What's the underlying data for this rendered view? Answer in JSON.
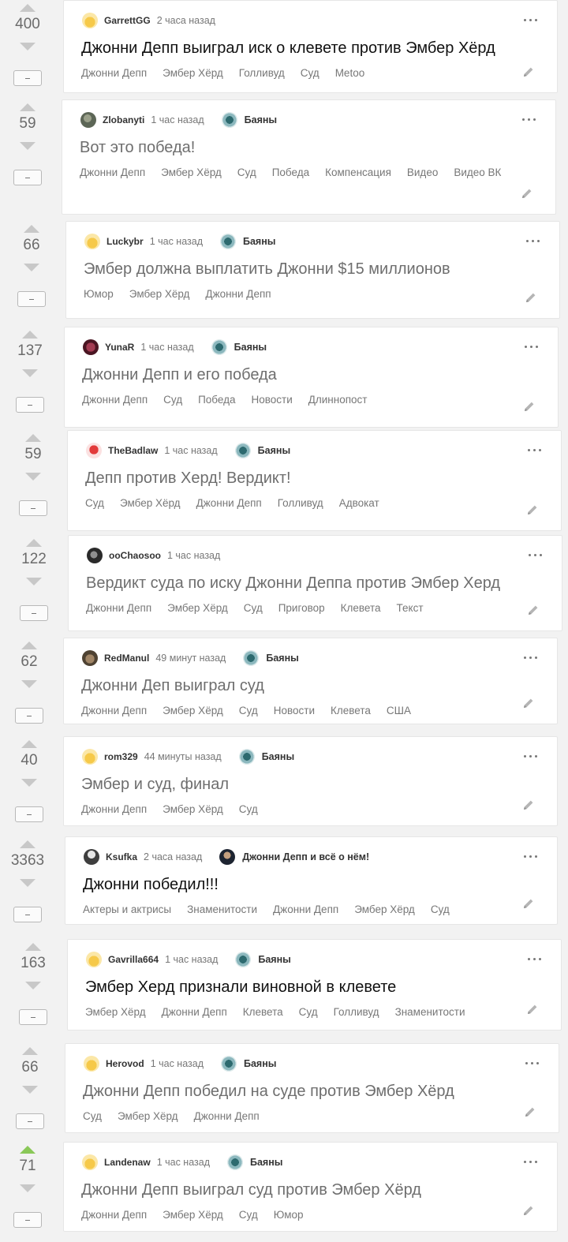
{
  "posts": [
    {
      "rating": "400",
      "author": "GarrettGG",
      "time": "2 часа назад",
      "community": "",
      "title": "Джонни Депп выиграл иск о клевете против Эмбер Хёрд",
      "title_style": "black",
      "avatar": "yellow-avatar-icon",
      "tags": [
        "Джонни Депп",
        "Эмбер Хёрд",
        "Голливуд",
        "Суд",
        "Metoo"
      ],
      "upvoted": false
    },
    {
      "rating": "59",
      "author": "Zlobanyti",
      "time": "1 час назад",
      "community": "Баяны",
      "title": "Вот это победа!",
      "title_style": "gray",
      "avatar": "gray-avatar-icon",
      "tags": [
        "Джонни Депп",
        "Эмбер Хёрд",
        "Суд",
        "Победа",
        "Компенсация",
        "Видео",
        "Видео ВК"
      ],
      "upvoted": false
    },
    {
      "rating": "66",
      "author": "Luckybr",
      "time": "1 час назад",
      "community": "Баяны",
      "title": "Эмбер должна выплатить Джонни $15 миллионов",
      "title_style": "gray",
      "avatar": "yellow-avatar-icon",
      "tags": [
        "Юмор",
        "Эмбер Хёрд",
        "Джонни Депп"
      ],
      "upvoted": false
    },
    {
      "rating": "137",
      "author": "YunaR",
      "time": "1 час назад",
      "community": "Баяны",
      "title": "Джонни Депп и его победа",
      "title_style": "gray",
      "avatar": "wine-avatar-icon",
      "tags": [
        "Джонни Депп",
        "Суд",
        "Победа",
        "Новости",
        "Длиннопост"
      ],
      "upvoted": false
    },
    {
      "rating": "59",
      "author": "TheBadlaw",
      "time": "1 час назад",
      "community": "Баяны",
      "title": "Депп против Херд! Вердикт!",
      "title_style": "gray",
      "avatar": "red-avatar-icon",
      "tags": [
        "Суд",
        "Эмбер Хёрд",
        "Джонни Депп",
        "Голливуд",
        "Адвокат"
      ],
      "upvoted": false
    },
    {
      "rating": "122",
      "author": "ooChaosoo",
      "time": "1 час назад",
      "community": "",
      "title": "Вердикт суда по иску Джонни Деппа против Эмбер Херд",
      "title_style": "gray",
      "avatar": "dark-avatar-icon",
      "tags": [
        "Джонни Депп",
        "Эмбер Хёрд",
        "Суд",
        "Приговор",
        "Клевета",
        "Текст"
      ],
      "upvoted": false
    },
    {
      "rating": "62",
      "author": "RedManul",
      "time": "49 минут назад",
      "community": "Баяны",
      "title": "Джонни Деп выиграл суд",
      "title_style": "gray",
      "avatar": "brown-avatar-icon",
      "tags": [
        "Джонни Депп",
        "Эмбер Хёрд",
        "Суд",
        "Новости",
        "Клевета",
        "США"
      ],
      "upvoted": false
    },
    {
      "rating": "40",
      "author": "rom329",
      "time": "44 минуты назад",
      "community": "Баяны",
      "title": "Эмбер и суд, финал",
      "title_style": "gray",
      "avatar": "yellow-avatar-icon",
      "tags": [
        "Джонни Депп",
        "Эмбер Хёрд",
        "Суд"
      ],
      "upvoted": false
    },
    {
      "rating": "3363",
      "author": "Ksufka",
      "time": "2 часа назад",
      "community": "Джонни Депп и всё о нём!",
      "title": "Джонни победил!!!",
      "title_style": "black",
      "avatar": "ksufka-avatar-icon",
      "tags": [
        "Актеры и актрисы",
        "Знаменитости",
        "Джонни Депп",
        "Эмбер Хёрд",
        "Суд"
      ],
      "upvoted": false
    },
    {
      "rating": "163",
      "author": "Gavrilla664",
      "time": "1 час назад",
      "community": "Баяны",
      "title": "Эмбер Херд признали виновной в клевете",
      "title_style": "black",
      "avatar": "yellow-avatar-icon",
      "tags": [
        "Эмбер Хёрд",
        "Джонни Депп",
        "Клевета",
        "Суд",
        "Голливуд",
        "Знаменитости"
      ],
      "upvoted": false
    },
    {
      "rating": "66",
      "author": "Herovod",
      "time": "1 час назад",
      "community": "Баяны",
      "title": "Джонни Депп победил на суде против Эмбер Хёрд",
      "title_style": "gray",
      "avatar": "yellow-avatar-icon",
      "tags": [
        "Суд",
        "Эмбер Хёрд",
        "Джонни Депп"
      ],
      "upvoted": false
    },
    {
      "rating": "71",
      "author": "Landenaw",
      "time": "1 час назад",
      "community": "Баяны",
      "title": "Джонни Депп выиграл суд против Эмбер Хёрд",
      "title_style": "gray",
      "avatar": "yellow-avatar-icon",
      "tags": [
        "Джонни Депп",
        "Эмбер Хёрд",
        "Суд",
        "Юмор"
      ],
      "upvoted": true
    }
  ],
  "colors": {
    "upvote_active": "#8ac858",
    "text_muted": "#777777",
    "card_bg": "#ffffff",
    "page_bg": "#f2f2f2"
  }
}
